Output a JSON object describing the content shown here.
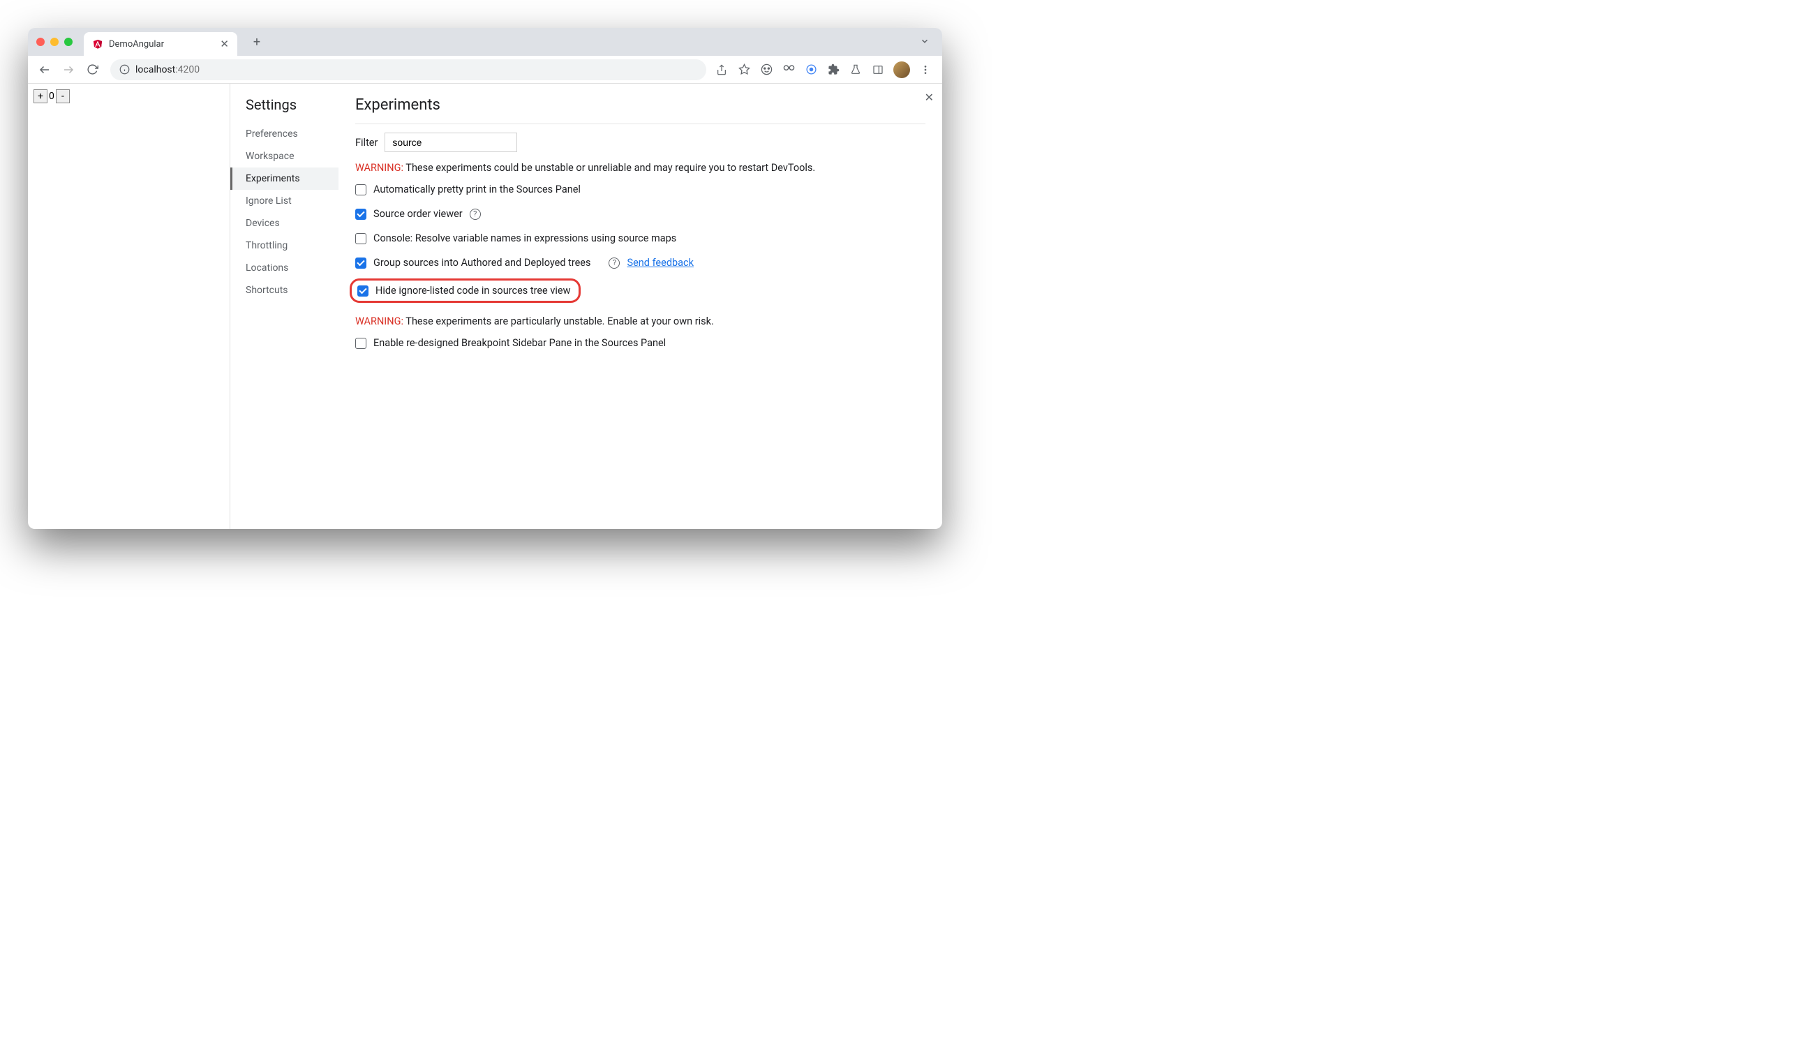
{
  "browser": {
    "tab_title": "DemoAngular",
    "url_host": "localhost",
    "url_port": ":4200"
  },
  "page": {
    "counter_value": "0",
    "plus": "+",
    "minus": "-"
  },
  "settings": {
    "title": "Settings",
    "nav": {
      "preferences": "Preferences",
      "workspace": "Workspace",
      "experiments": "Experiments",
      "ignore_list": "Ignore List",
      "devices": "Devices",
      "throttling": "Throttling",
      "locations": "Locations",
      "shortcuts": "Shortcuts"
    }
  },
  "experiments": {
    "heading": "Experiments",
    "filter_label": "Filter",
    "filter_value": "source",
    "warning1_label": "WARNING:",
    "warning1_text": " These experiments could be unstable or unreliable and may require you to restart DevTools.",
    "items": {
      "pretty_print": {
        "label": "Automatically pretty print in the Sources Panel"
      },
      "source_order": {
        "label": "Source order viewer"
      },
      "console_resolve": {
        "label": "Console: Resolve variable names in expressions using source maps"
      },
      "group_sources": {
        "label": "Group sources into Authored and Deployed trees",
        "feedback": "Send feedback"
      },
      "hide_ignore": {
        "label": "Hide ignore-listed code in sources tree view"
      },
      "breakpoint_sidebar": {
        "label": "Enable re-designed Breakpoint Sidebar Pane in the Sources Panel"
      }
    },
    "warning2_label": "WARNING:",
    "warning2_text": " These experiments are particularly unstable. Enable at your own risk."
  }
}
